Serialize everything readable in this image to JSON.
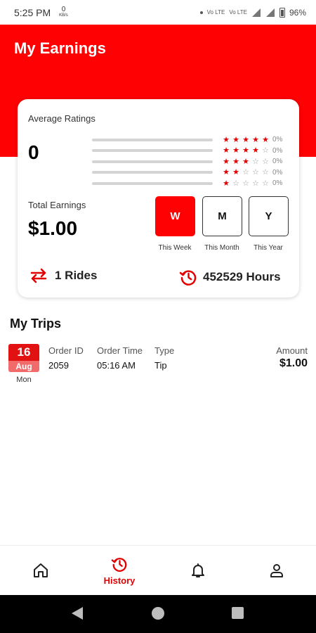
{
  "status_bar": {
    "time": "5:25 PM",
    "data_rate": "0",
    "data_unit": "KB/s",
    "battery": "96%",
    "volte_1": "Vo LTE",
    "volte_2": "Vo LTE"
  },
  "header": {
    "title": "My Earnings"
  },
  "card": {
    "average_ratings_label": "Average Ratings",
    "average_rating_value": "0",
    "rating_rows": [
      {
        "stars": 5,
        "percent": "0%"
      },
      {
        "stars": 4,
        "percent": "0%"
      },
      {
        "stars": 3,
        "percent": "0%"
      },
      {
        "stars": 2,
        "percent": "0%"
      },
      {
        "stars": 1,
        "percent": "0%"
      }
    ],
    "total_earnings_label": "Total Earnings",
    "total_earnings_value": "$1.00",
    "periods": [
      {
        "key": "W",
        "label": "This Week",
        "active": true
      },
      {
        "key": "M",
        "label": "This Month",
        "active": false
      },
      {
        "key": "Y",
        "label": "This Year",
        "active": false
      }
    ],
    "rides_text": "1 Rides",
    "hours_text": "452529 Hours"
  },
  "trips": {
    "title": "My Trips",
    "items": [
      {
        "day": "16",
        "month": "Aug",
        "weekday": "Mon",
        "order_id_label": "Order ID",
        "order_id": "2059",
        "order_time_label": "Order Time",
        "order_time": "05:16 AM",
        "type_label": "Type",
        "type": "Tip",
        "amount_label": "Amount",
        "amount": "$1.00"
      }
    ]
  },
  "bottom_nav": {
    "history_label": "History",
    "active": "history"
  },
  "colors": {
    "brand_red": "#fd0103",
    "star_red": "#e30000",
    "date_top": "#e21212",
    "date_bottom": "#f26b6b"
  },
  "icons": [
    "home-icon",
    "history-icon",
    "bell-icon",
    "profile-icon",
    "swap-arrows-icon",
    "clock-history-icon"
  ]
}
